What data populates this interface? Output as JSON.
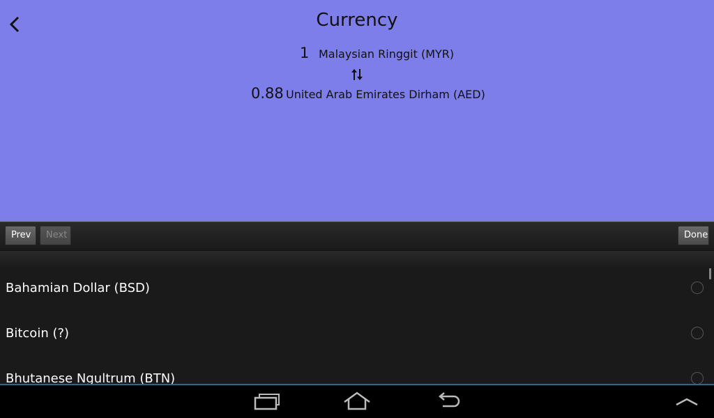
{
  "header": {
    "title": "Currency",
    "back_icon": "chevron-left-icon"
  },
  "conversion": {
    "from_amount": "1",
    "from_currency": "Malaysian Ringgit (MYR)",
    "swap_icon": "swap-vertical-icon",
    "to_amount": "0.88",
    "to_currency": "United Arab Emirates Dirham (AED)"
  },
  "toolbar": {
    "prev_label": "Prev",
    "next_label": "Next",
    "done_label": "Done"
  },
  "list": {
    "items": [
      {
        "label": "Bahamian Dollar (BSD)",
        "selected": false
      },
      {
        "label": "Bitcoin (?)",
        "selected": false
      },
      {
        "label": "Bhutanese Ngultrum (BTN)",
        "selected": false
      }
    ]
  },
  "navbar": {
    "recent_icon": "recent-apps-icon",
    "home_icon": "home-icon",
    "back_icon": "back-arrow-icon",
    "menu_icon": "chevron-up-icon"
  },
  "colors": {
    "app_background": "#7e7eeb",
    "list_background": "#1a1a1a"
  }
}
